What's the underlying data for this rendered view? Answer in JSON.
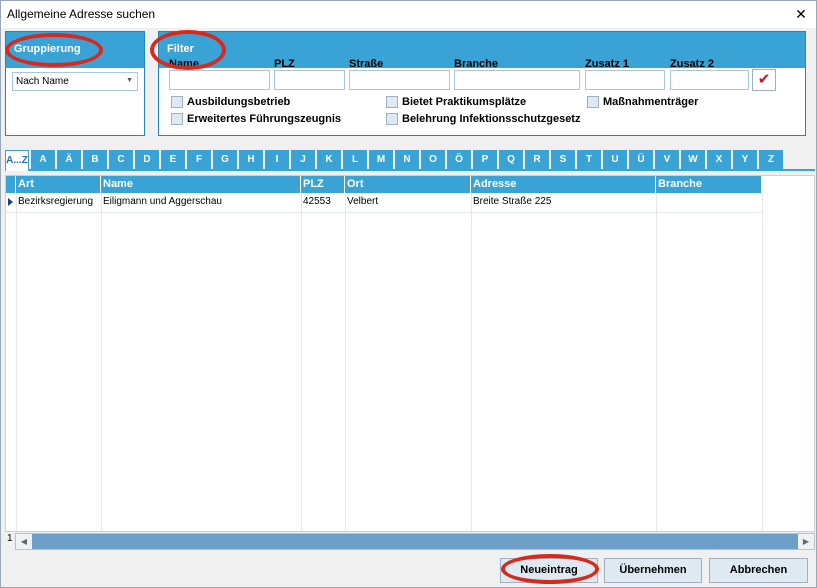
{
  "window": {
    "title": "Allgemeine Adresse suchen"
  },
  "group": {
    "title": "Gruppierung",
    "selected": "Nach Name"
  },
  "filter": {
    "title": "Filter",
    "fields": [
      "Name",
      "PLZ",
      "Straße",
      "Branche",
      "Zusatz 1",
      "Zusatz 2"
    ],
    "values": [
      "",
      "",
      "",
      "",
      "",
      ""
    ],
    "checkboxes": [
      "Ausbildungsbetrieb",
      "Bietet Praktikumsplätze",
      "Maßnahmenträger",
      "Erweitertes Führungszeugnis",
      "Belehrung Infektionsschutzgesetz"
    ]
  },
  "tabs": [
    "A...Z",
    "A",
    "Ä",
    "B",
    "C",
    "D",
    "E",
    "F",
    "G",
    "H",
    "I",
    "J",
    "K",
    "L",
    "M",
    "N",
    "O",
    "Ö",
    "P",
    "Q",
    "R",
    "S",
    "T",
    "U",
    "Ü",
    "V",
    "W",
    "X",
    "Y",
    "Z"
  ],
  "grid": {
    "columns": [
      "Art",
      "Name",
      "PLZ",
      "Ort",
      "Adresse",
      "Branche"
    ],
    "rows": [
      [
        "Bezirksregierung",
        "Eiligmann und Aggerschau",
        "42553",
        "Velbert",
        "Breite Straße 225",
        ""
      ]
    ]
  },
  "footer": {
    "count": "1"
  },
  "buttons": {
    "new": "Neueintrag",
    "take": "Übernehmen",
    "cancel": "Abbrechen"
  },
  "colors": {
    "accent": "#3aa3d6",
    "highlight_ring": "#d8291d",
    "check": "#c2161e"
  },
  "icons": {
    "close": "close-icon",
    "confirm": "checkmark-icon"
  }
}
